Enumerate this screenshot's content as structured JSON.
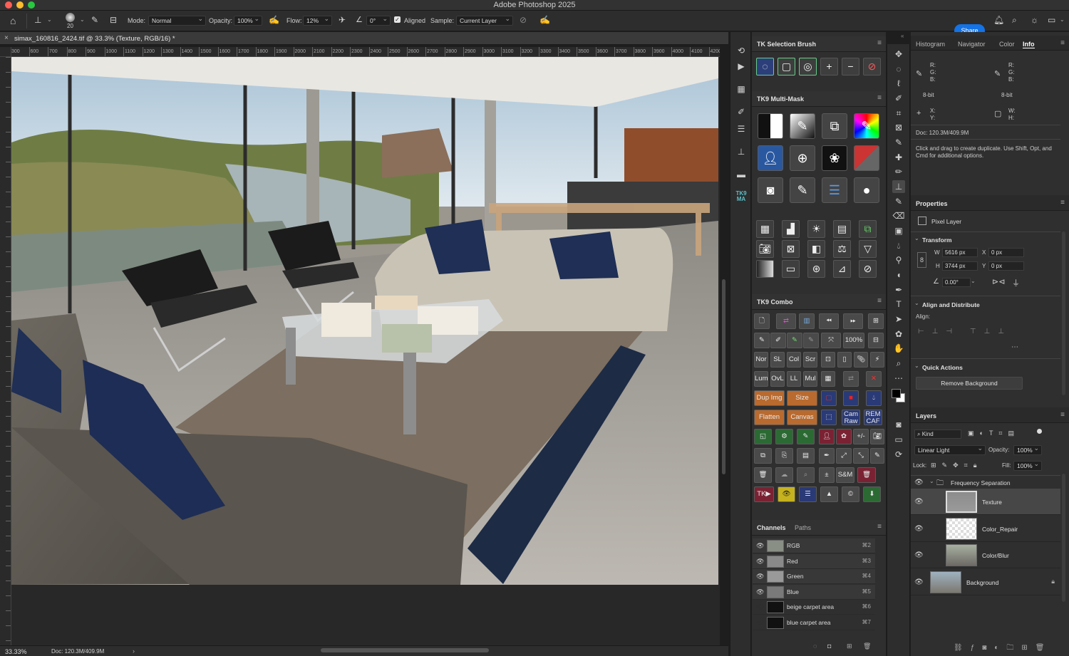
{
  "app": {
    "title": "Adobe Photoshop 2025"
  },
  "options_bar": {
    "brush_size": "20",
    "mode_label": "Mode:",
    "mode_value": "Normal",
    "opacity_label": "Opacity:",
    "opacity_value": "100%",
    "flow_label": "Flow:",
    "flow_value": "12%",
    "angle_value": "0°",
    "aligned_label": "Aligned",
    "sample_label": "Sample:",
    "sample_value": "Current Layer",
    "share_label": "Share"
  },
  "document": {
    "tab_title": "simax_160816_2424.tif @ 33.3% (Texture, RGB/16) *",
    "zoom": "33.33%",
    "doc_size": "Doc: 120.3M/409.9M",
    "ruler_ticks": [
      "300",
      "600",
      "700",
      "800",
      "900",
      "1000",
      "1100",
      "1200",
      "1300",
      "1400",
      "1500",
      "1600",
      "1700",
      "1800",
      "1900",
      "2000",
      "2100",
      "2200",
      "2300",
      "2400",
      "2500",
      "2600",
      "2700",
      "2800",
      "2900",
      "3000",
      "3100",
      "3200",
      "3300",
      "3400",
      "3500",
      "3600",
      "3700",
      "3800",
      "3900",
      "4000",
      "4100",
      "4200"
    ]
  },
  "tk_selection_brush": {
    "title": "TK Selection Brush"
  },
  "tk_multimask": {
    "title": "TK9 Multi-Mask"
  },
  "tk_combo": {
    "title": "TK9 Combo",
    "zoom_label": "100%",
    "row3": [
      "Nor",
      "SL",
      "Col",
      "Scr"
    ],
    "row4": [
      "Lum",
      "OvL",
      "LL",
      "Mul"
    ],
    "row5": [
      "Dup Img",
      "Size"
    ],
    "row6": [
      "Flatten",
      "Canvas",
      "Cam Raw",
      "REM CAF"
    ],
    "sm_label": "S&M",
    "pm_label": "+/-",
    "tk_label": "TK"
  },
  "strip": {
    "tk9ma": "TK9\nMA"
  },
  "channels": {
    "tab_channels": "Channels",
    "tab_paths": "Paths",
    "rows": [
      {
        "name": "RGB",
        "key": "⌘2"
      },
      {
        "name": "Red",
        "key": "⌘3"
      },
      {
        "name": "Green",
        "key": "⌘4"
      },
      {
        "name": "Blue",
        "key": "⌘5"
      },
      {
        "name": "beige carpet area",
        "key": "⌘6"
      },
      {
        "name": "blue carpet area",
        "key": "⌘7"
      }
    ]
  },
  "info_panel": {
    "tabs": [
      "Histogram",
      "Navigator",
      "Color",
      "Info"
    ],
    "rgb_labels": "R:\nG:\nB:",
    "bit1": "8-bit",
    "bit2": "8-bit",
    "xy_labels": "X:\nY:",
    "wh_labels": "W:\nH:",
    "doc": "Doc: 120.3M/409.9M",
    "hint": "Click and drag to create duplicate.  Use Shift, Opt, and Cmd for additional options."
  },
  "properties": {
    "title": "Properties",
    "layer_type": "Pixel Layer",
    "transform_title": "Transform",
    "w_label": "W",
    "w_value": "5616 px",
    "h_label": "H",
    "h_value": "3744 px",
    "x_label": "X",
    "x_value": "0 px",
    "y_label": "Y",
    "y_value": "0 px",
    "angle_value": "0.00°",
    "align_title": "Align and Distribute",
    "align_label": "Align:",
    "quick_title": "Quick Actions",
    "remove_bg": "Remove Background"
  },
  "layers": {
    "title": "Layers",
    "kind_label": "Kind",
    "blend_mode": "Linear Light",
    "opacity_label": "Opacity:",
    "opacity_value": "100%",
    "lock_label": "Lock:",
    "fill_label": "Fill:",
    "fill_value": "100%",
    "group_name": "Frequency Separation",
    "items": [
      {
        "name": "Texture"
      },
      {
        "name": "Color_Repair"
      },
      {
        "name": "Color/Blur"
      },
      {
        "name": "Background"
      }
    ]
  }
}
